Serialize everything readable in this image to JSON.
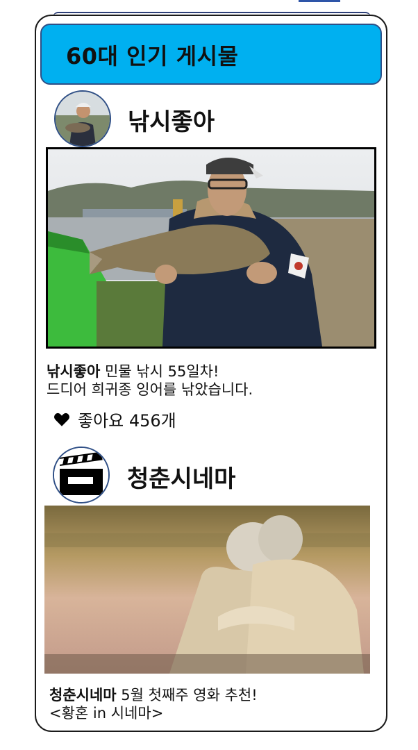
{
  "header": {
    "title": "60대 인기 게시물"
  },
  "posts": [
    {
      "username": "낚시좋아",
      "caption_user": "낚시좋아",
      "caption_line1": "민물 낚시 55일차!",
      "caption_line2": "드디어 희귀종 잉어를 낚았습니다.",
      "likes_text": "좋아요 456개",
      "avatar_icon": "fisherman-photo",
      "image": "man-holding-carp-photo"
    },
    {
      "username": "청춘시네마",
      "caption_user": "청춘시네마",
      "caption_line1": "5월 첫째주 영화 추천!",
      "caption_line2": "<황혼 in 시네마>",
      "avatar_icon": "clapperboard-icon",
      "image": "elderly-couple-sunset-photo"
    }
  ],
  "colors": {
    "header_bg": "#00b0f0",
    "border_navy": "#2f4f86",
    "text": "#111111"
  }
}
